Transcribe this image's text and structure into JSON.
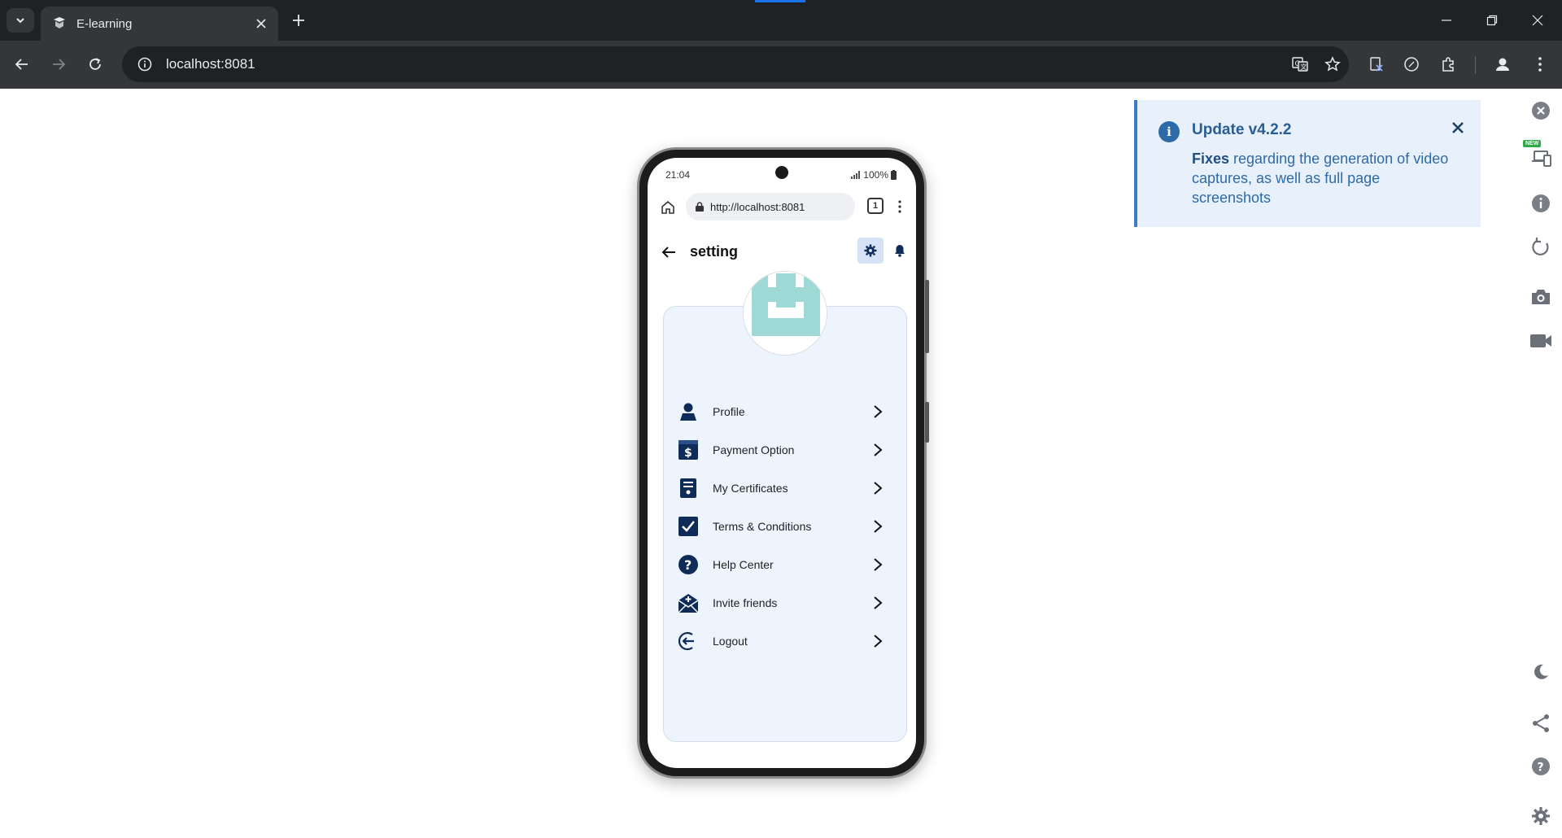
{
  "browser": {
    "tab_title": "E-learning",
    "address": "localhost:8081"
  },
  "phone": {
    "status_time": "21:04",
    "battery": "100%",
    "mobile_url": "http://localhost:8081",
    "tab_count": "1",
    "page_title": "setting",
    "menu": [
      {
        "label": "Profile",
        "icon": "person-icon"
      },
      {
        "label": "Payment Option",
        "icon": "dollar-icon"
      },
      {
        "label": "My Certificates",
        "icon": "certificate-icon"
      },
      {
        "label": "Terms & Conditions",
        "icon": "checkbox-icon"
      },
      {
        "label": "Help Center",
        "icon": "question-icon"
      },
      {
        "label": "Invite friends",
        "icon": "mail-plus-icon"
      },
      {
        "label": "Logout",
        "icon": "logout-icon"
      }
    ]
  },
  "notification": {
    "title": "Update v4.2.2",
    "body_bold": "Fixes",
    "body_rest": " regarding the generation of video captures, as well as full page screenshots"
  },
  "side_panel": {
    "new_badge": "NEW"
  },
  "colors": {
    "accent_dark": "#0f2c59",
    "card_bg": "#eef4fd",
    "toast_bg": "#e8f1fb",
    "avatar_teal": "#9ed9d6"
  }
}
